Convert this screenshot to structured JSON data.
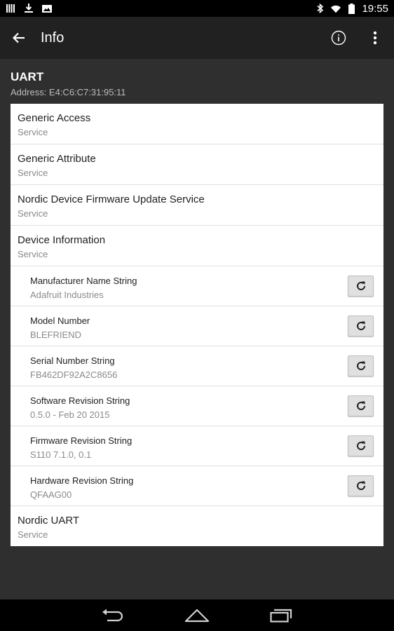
{
  "status_bar": {
    "time": "19:55",
    "left_icons": [
      "bars-icon",
      "download-icon",
      "photo-icon"
    ],
    "right_icons": [
      "bluetooth-icon",
      "wifi-icon",
      "battery-icon"
    ]
  },
  "app_bar": {
    "title": "Info",
    "actions": [
      "info-icon",
      "overflow-menu-icon"
    ]
  },
  "device": {
    "name": "UART",
    "address": "Address: E4:C6:C7:31:95:11"
  },
  "list": [
    {
      "kind": "service",
      "title": "Generic Access",
      "subtitle": "Service"
    },
    {
      "kind": "service",
      "title": "Generic Attribute",
      "subtitle": "Service"
    },
    {
      "kind": "service",
      "title": "Nordic Device Firmware Update Service",
      "subtitle": "Service"
    },
    {
      "kind": "service",
      "title": "Device Information",
      "subtitle": "Service"
    },
    {
      "kind": "characteristic",
      "title": "Manufacturer Name String",
      "subtitle": "Adafruit Industries"
    },
    {
      "kind": "characteristic",
      "title": "Model Number",
      "subtitle": "BLEFRIEND"
    },
    {
      "kind": "characteristic",
      "title": "Serial Number String",
      "subtitle": "FB462DF92A2C8656"
    },
    {
      "kind": "characteristic",
      "title": "Software Revision String",
      "subtitle": "0.5.0 - Feb 20 2015"
    },
    {
      "kind": "characteristic",
      "title": "Firmware Revision String",
      "subtitle": "S110 7.1.0, 0.1"
    },
    {
      "kind": "characteristic",
      "title": "Hardware Revision String",
      "subtitle": "QFAAG00"
    },
    {
      "kind": "service",
      "title": "Nordic UART",
      "subtitle": "Service"
    }
  ],
  "nav_bar": {
    "buttons": [
      "back-nav-icon",
      "home-nav-icon",
      "recents-nav-icon"
    ]
  },
  "colors": {
    "background": "#2f2f2f",
    "app_bar": "#212121",
    "card": "#ffffff",
    "title_text": "#212121",
    "subtitle_text": "#8a8a8a"
  }
}
